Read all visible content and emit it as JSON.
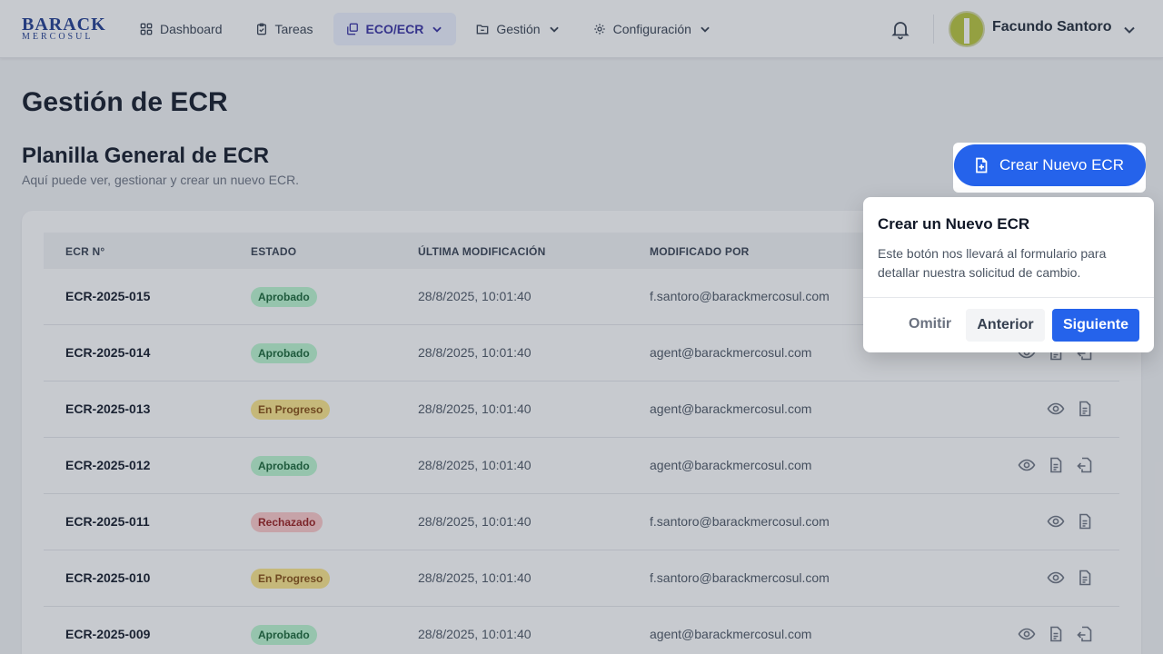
{
  "brand": {
    "line1": "BARACK",
    "line2": "MERCOSUL"
  },
  "nav": {
    "dashboard": "Dashboard",
    "tareas": "Tareas",
    "eco": "ECO/ECR",
    "gestion": "Gestión",
    "config": "Configuración"
  },
  "user": {
    "name": "Facundo Santoro"
  },
  "page": {
    "title": "Gestión de ECR",
    "section_title": "Planilla General de ECR",
    "section_sub": "Aquí puede ver, gestionar y crear un nuevo ECR.",
    "new_button": "Crear Nuevo ECR"
  },
  "table": {
    "headers": {
      "num": "ECR N°",
      "estado": "ESTADO",
      "modif": "ÚLTIMA MODIFICACIÓN",
      "por": "MODIFICADO POR"
    },
    "rows": [
      {
        "num": "ECR-2025-015",
        "estado": "Aprobado",
        "fecha": "28/8/2025, 10:01:40",
        "por": "f.santoro@barackmercosul.com"
      },
      {
        "num": "ECR-2025-014",
        "estado": "Aprobado",
        "fecha": "28/8/2025, 10:01:40",
        "por": "agent@barackmercosul.com"
      },
      {
        "num": "ECR-2025-013",
        "estado": "En Progreso",
        "fecha": "28/8/2025, 10:01:40",
        "por": "agent@barackmercosul.com"
      },
      {
        "num": "ECR-2025-012",
        "estado": "Aprobado",
        "fecha": "28/8/2025, 10:01:40",
        "por": "agent@barackmercosul.com"
      },
      {
        "num": "ECR-2025-011",
        "estado": "Rechazado",
        "fecha": "28/8/2025, 10:01:40",
        "por": "f.santoro@barackmercosul.com"
      },
      {
        "num": "ECR-2025-010",
        "estado": "En Progreso",
        "fecha": "28/8/2025, 10:01:40",
        "por": "f.santoro@barackmercosul.com"
      },
      {
        "num": "ECR-2025-009",
        "estado": "Aprobado",
        "fecha": "28/8/2025, 10:01:40",
        "por": "agent@barackmercosul.com"
      }
    ]
  },
  "tour": {
    "title": "Crear un Nuevo ECR",
    "desc": "Este botón nos llevará al formulario para detallar nuestra solicitud de cambio.",
    "skip": "Omitir",
    "prev": "Anterior",
    "next": "Siguiente"
  },
  "colors": {
    "primary": "#2563eb",
    "approved": "#166534",
    "progress": "#854d0e",
    "rejected": "#991b1b"
  }
}
